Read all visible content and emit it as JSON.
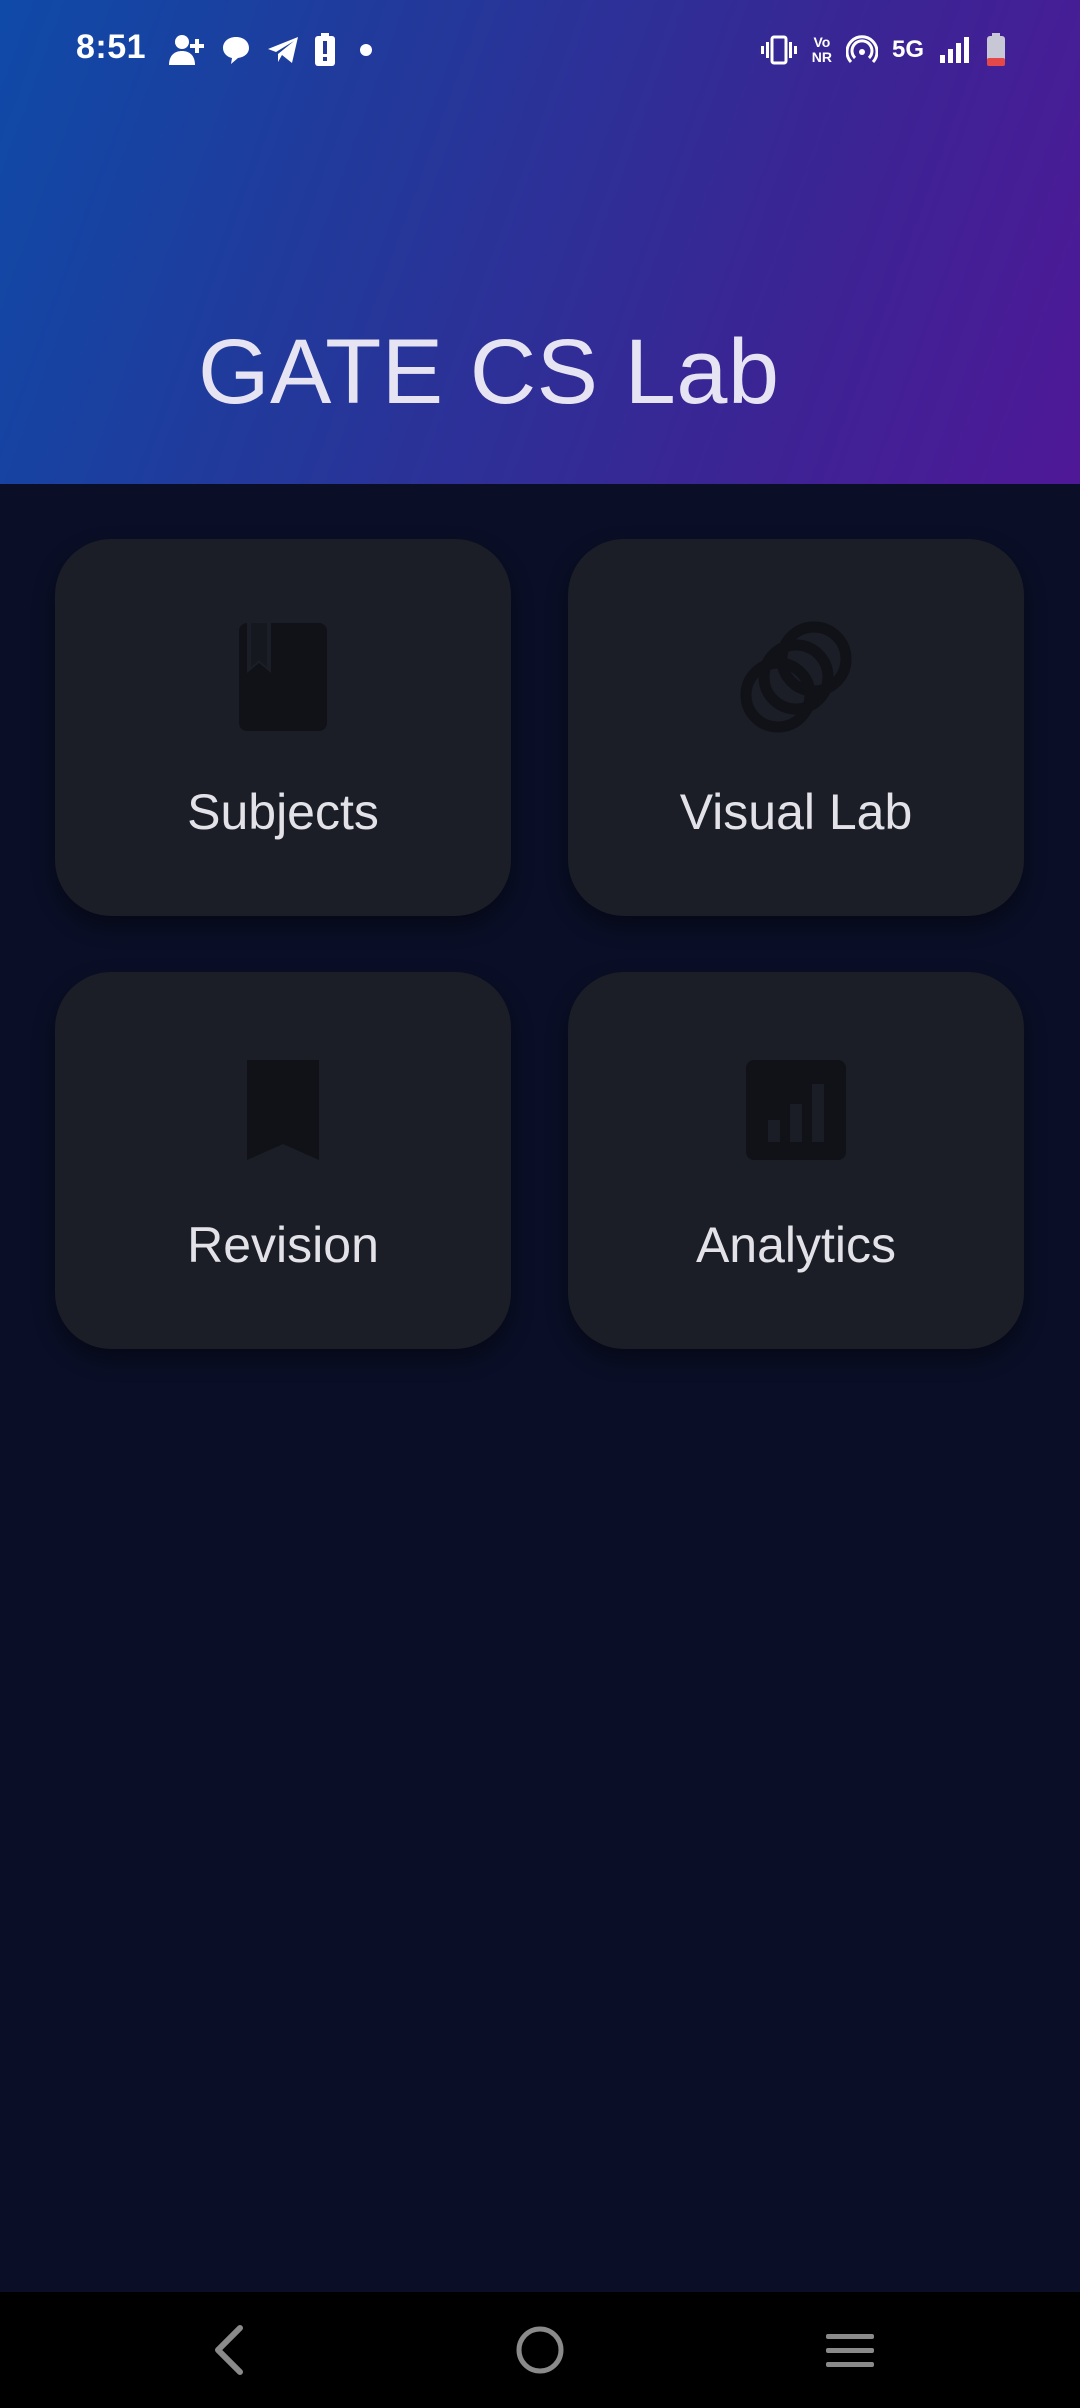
{
  "status_bar": {
    "time": "8:51",
    "network_label": "5G",
    "vonr_top": "Vo",
    "vonr_bottom": "NR",
    "left_icons": [
      "add-person-icon",
      "chat-bubble-icon",
      "telegram-icon",
      "battery-alert-icon",
      "dot-icon"
    ],
    "right_icons": [
      "vibrate-icon",
      "vonr-icon",
      "hotspot-icon",
      "network-5g-icon",
      "signal-icon",
      "battery-icon"
    ]
  },
  "header": {
    "title": "GATE CS Lab",
    "gradient_colors": [
      "#0f4aa8",
      "#23389a",
      "#3a2594",
      "#4f1897"
    ]
  },
  "cards": [
    {
      "label": "Subjects",
      "icon": "book-icon"
    },
    {
      "label": "Visual Lab",
      "icon": "circles-icon"
    },
    {
      "label": "Revision",
      "icon": "bookmark-icon"
    },
    {
      "label": "Analytics",
      "icon": "bar-chart-icon"
    }
  ],
  "nav_bar": {
    "buttons": [
      "back-icon",
      "home-icon",
      "recents-icon"
    ]
  },
  "colors": {
    "background": "#0a0f27",
    "card": "#1b1e26",
    "card_icon": "#101218",
    "text": "#e2e2e8",
    "battery_low": "#e54848"
  }
}
